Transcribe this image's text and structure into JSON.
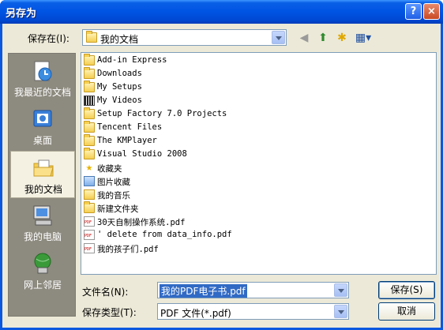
{
  "window": {
    "title": "另存为",
    "help_glyph": "?",
    "close_glyph": "×"
  },
  "toolbar": {
    "save_in_label": "保存在(I):",
    "save_in_value": "我的文档",
    "back_icon": "back-arrow-icon",
    "up_icon": "up-folder-icon",
    "new_folder_icon": "new-folder-icon",
    "view_menu_icon": "view-menu-icon"
  },
  "places": [
    {
      "label": "我最近的文档",
      "icon": "recent-documents-icon"
    },
    {
      "label": "桌面",
      "icon": "desktop-icon"
    },
    {
      "label": "我的文档",
      "icon": "my-documents-icon"
    },
    {
      "label": "我的电脑",
      "icon": "my-computer-icon"
    },
    {
      "label": "网上邻居",
      "icon": "network-places-icon"
    }
  ],
  "files": [
    {
      "name": "Add-in Express",
      "type": "folder"
    },
    {
      "name": "Downloads",
      "type": "folder"
    },
    {
      "name": "My Setups",
      "type": "folder"
    },
    {
      "name": "My Videos",
      "type": "video"
    },
    {
      "name": "Setup Factory 7.0 Projects",
      "type": "folder"
    },
    {
      "name": "Tencent Files",
      "type": "folder"
    },
    {
      "name": "The KMPlayer",
      "type": "folder"
    },
    {
      "name": "Visual Studio 2008",
      "type": "folder"
    },
    {
      "name": "收藏夹",
      "type": "favorites"
    },
    {
      "name": "图片收藏",
      "type": "pictures"
    },
    {
      "name": "我的音乐",
      "type": "music"
    },
    {
      "name": "新建文件夹",
      "type": "folder"
    },
    {
      "name": "30天自制操作系统.pdf",
      "type": "pdf"
    },
    {
      "name": "' delete from data_info.pdf",
      "type": "pdf"
    },
    {
      "name": "我的孩子们.pdf",
      "type": "pdf"
    }
  ],
  "bottom": {
    "filename_label": "文件名(N):",
    "filename_value": "我的PDF电子书.pdf",
    "filetype_label": "保存类型(T):",
    "filetype_value": "PDF 文件(*.pdf)",
    "save_button": "保存(S)",
    "cancel_button": "取消"
  }
}
